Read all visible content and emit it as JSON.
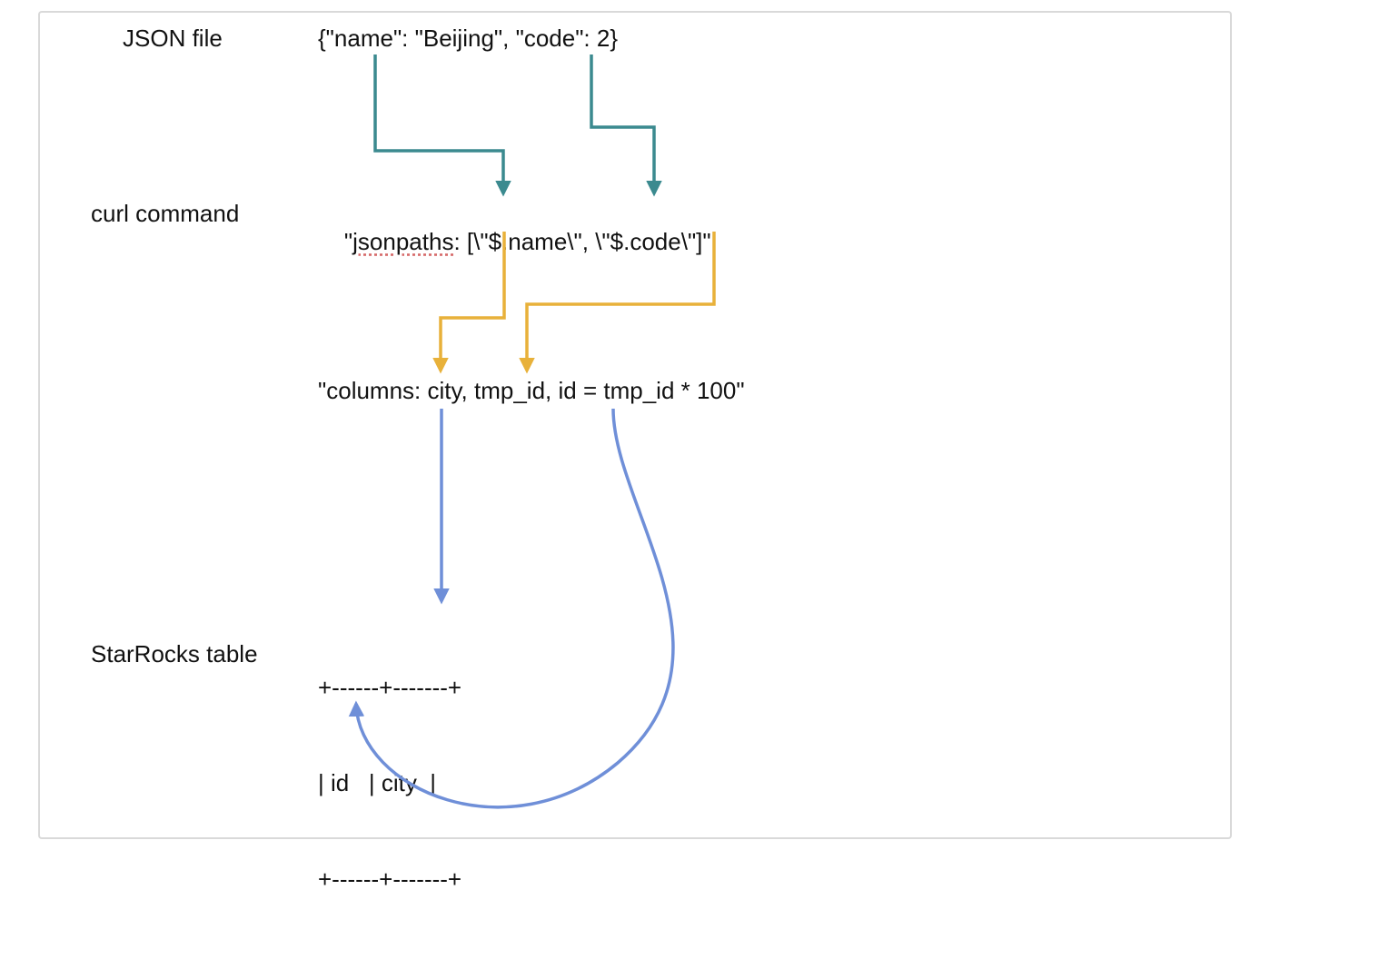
{
  "diagram": {
    "labels": {
      "json_file": "JSON file",
      "curl_command": "curl command",
      "starrocks_table": "StarRocks table"
    },
    "json_content": "{\"name\": \"Beijing\", \"code\": 2}",
    "curl_jsonpaths_prefix": "\"",
    "curl_jsonpaths_word": "jsonpaths",
    "curl_jsonpaths_suffix": ": [\\\"$.name\\\", \\\"$.code\\\"]\"",
    "curl_columns": "\"columns: city, tmp_id, id = tmp_id * 100\"",
    "table_border_top": "+------+-------+",
    "table_row": "| id   | city  |",
    "table_border_bot": "+------+-------+",
    "colors": {
      "teal": "#3b8a8f",
      "yellow": "#e8b13a",
      "blue": "#6f8fd8",
      "frame": "#d9d9d9"
    }
  }
}
